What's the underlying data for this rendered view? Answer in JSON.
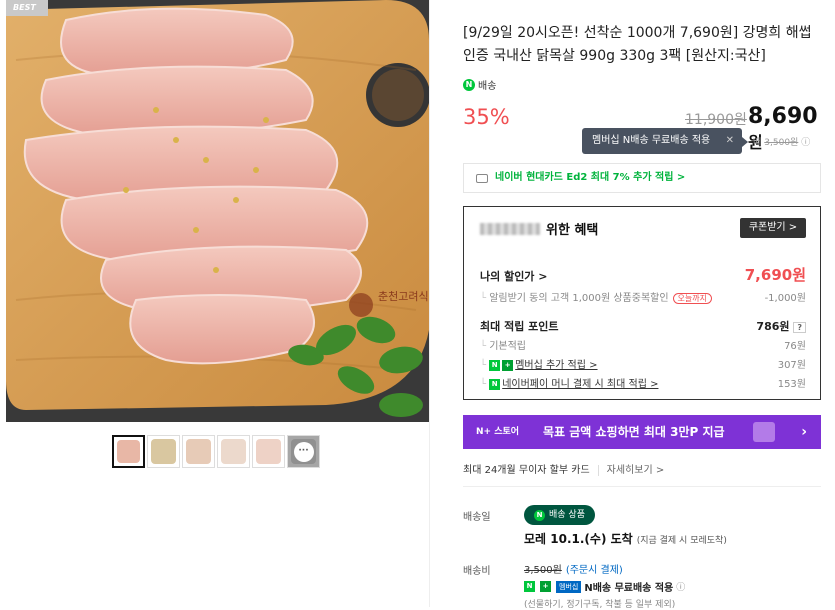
{
  "gallery": {
    "best_label": "BEST",
    "watermark": "춘천고려식품",
    "thumbs": [
      {
        "active": true
      },
      {
        "active": false
      },
      {
        "active": false
      },
      {
        "active": false
      },
      {
        "active": false
      },
      {
        "more": true,
        "more_label": "···"
      }
    ]
  },
  "product": {
    "title": "[9/29일 20시오픈! 선착순 1000개 7,690원] 강명희 해썹인증 국내산 닭목살 990g 330g 3팩 [원산지:국산]",
    "delivery_badge": "배송",
    "discount_pct": "35%",
    "original_price": "11,900원",
    "price": "8,690",
    "price_unit": "원",
    "tooltip": "멤버십 N배송 무료배송 적용",
    "tooltip_close": "✕",
    "ship_label": "배",
    "ship_fee": "3,500원",
    "ship_info": "ⓘ"
  },
  "card_promo": "네이버 현대카드 Ed2 최대 7% 추가 적립 >",
  "benefit": {
    "header_suffix": "위한 혜택",
    "coupon_button": "쿠폰받기 >",
    "my_price_label": "나의 할인가 >",
    "my_price": "7,690원",
    "discount_desc": "알림받기 동의 고객 1,000원 상품중복할인",
    "discount_tag": "오늘까지",
    "discount_amt": "-1,000원",
    "points_label": "최대 적립 포인트",
    "points_total": "786원",
    "points_help": "?",
    "base_label": "기본적립",
    "base_amt": "76원",
    "member_label": "멤버십 추가 적립 >",
    "member_amt": "307원",
    "pay_label": "네이버페이 머니 결제 시 최대 적립 >",
    "pay_amt": "153원"
  },
  "banner": {
    "store": "N+ 스토어",
    "message": "목표 금액 쇼핑하면 최대 3만P 지급",
    "arrow": "›"
  },
  "installment": {
    "text": "최대 24개월 무이자 할부 카드",
    "more": "자세히보기 >"
  },
  "delivery": {
    "date_label": "배송일",
    "badge": "배송 상품",
    "arrival": "모레 10.1.(수) 도착",
    "arrival_note": "(지금 결제 시 모레도착)",
    "fee_label": "배송비",
    "fee_original": "3,500원",
    "fee_note": "(주문시 결제)",
    "free_label": "N배송 무료배송 적용",
    "member_tag": "멤버십",
    "note": "(선물하기, 정기구독, 착불 등 일부 제외)"
  },
  "colors": {
    "accent_red": "#f04f52",
    "naver_green": "#00c73c",
    "banner_purple": "#7e32d6"
  }
}
